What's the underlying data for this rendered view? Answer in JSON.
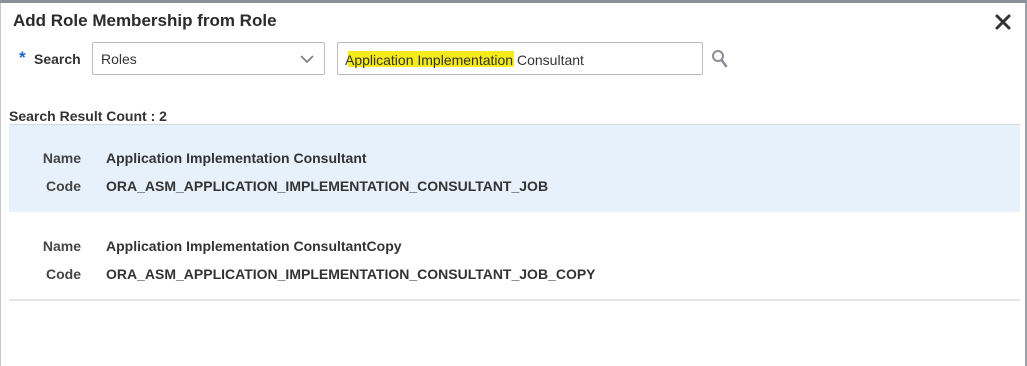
{
  "dialog": {
    "title": "Add Role Membership from Role"
  },
  "search": {
    "required_marker": "*",
    "label": "Search",
    "type_selected": "Roles",
    "query": "Application Implementation Consultant",
    "highlight_color": "#f5ea1a"
  },
  "results": {
    "count_label": "Search Result Count : 2",
    "items": [
      {
        "name_label": "Name",
        "name": "Application Implementation Consultant",
        "code_label": "Code",
        "code": "ORA_ASM_APPLICATION_IMPLEMENTATION_CONSULTANT_JOB"
      },
      {
        "name_label": "Name",
        "name": "Application Implementation ConsultantCopy",
        "code_label": "Code",
        "code": "ORA_ASM_APPLICATION_IMPLEMENTATION_CONSULTANT_JOB_COPY"
      }
    ]
  },
  "colors": {
    "selected_row_bg": "#e6f1fb",
    "required_star": "#1b6ac9"
  },
  "icons": {
    "close": "close-icon",
    "chevron": "chevron-down-icon",
    "search": "search-icon"
  }
}
